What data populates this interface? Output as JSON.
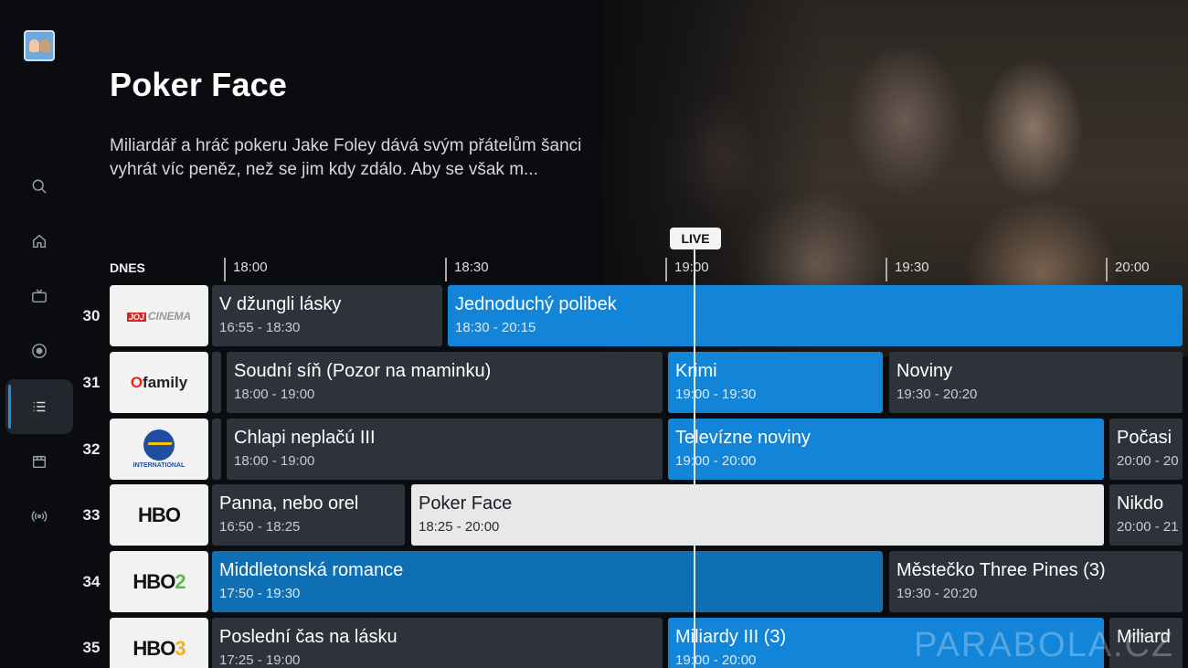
{
  "sidebar": {
    "items": [
      {
        "icon": "search-icon"
      },
      {
        "icon": "home-icon"
      },
      {
        "icon": "tv-icon"
      },
      {
        "icon": "record-icon"
      },
      {
        "icon": "list-icon",
        "active": true
      },
      {
        "icon": "movie-icon"
      },
      {
        "icon": "broadcast-icon"
      }
    ]
  },
  "hero": {
    "title": "Poker Face",
    "description": "Miliardář a hráč pokeru Jake Foley dává svým přátelům šanci vyhrát víc peněz, než se jim kdy zdálo. Aby se však m..."
  },
  "timeline": {
    "day_label": "DNES",
    "ticks": [
      "18:00",
      "18:30",
      "19:00",
      "19:30",
      "20:00"
    ],
    "live_label": "LIVE"
  },
  "channels": [
    {
      "number": "30",
      "logo": "JOJ CINEMA",
      "programs": [
        {
          "title": "V džungli lásky",
          "time": "16:55 - 18:30"
        },
        {
          "title": "Jednoduchý polibek",
          "time": "18:30 - 20:15"
        }
      ]
    },
    {
      "number": "31",
      "logo": "family",
      "programs": [
        {
          "title": "Soudní síň (Pozor na maminku)",
          "time": "18:00 - 19:00"
        },
        {
          "title": "Krimi",
          "time": "19:00 - 19:30"
        },
        {
          "title": "Noviny",
          "time": "19:30 - 20:20"
        }
      ]
    },
    {
      "number": "32",
      "logo": "INTERNATIONAL",
      "programs": [
        {
          "title": "Chlapi neplačú III",
          "time": "18:00 - 19:00"
        },
        {
          "title": "Televízne noviny",
          "time": "19:00 - 20:00"
        },
        {
          "title": "Počasi",
          "time": "20:00 - 20"
        }
      ]
    },
    {
      "number": "33",
      "logo": "HBO",
      "programs": [
        {
          "title": "Panna, nebo orel",
          "time": "16:50 - 18:25"
        },
        {
          "title": "Poker Face",
          "time": "18:25 - 20:00"
        },
        {
          "title": "Nikdo",
          "time": "20:00 - 21"
        }
      ]
    },
    {
      "number": "34",
      "logo": "HBO2",
      "programs": [
        {
          "title": "Middletonská romance",
          "time": "17:50 - 19:30"
        },
        {
          "title": "Městečko Three Pines (3)",
          "time": "19:30 - 20:20"
        }
      ]
    },
    {
      "number": "35",
      "logo": "HBO3",
      "programs": [
        {
          "title": "Poslední čas na lásku",
          "time": "17:25 - 19:00"
        },
        {
          "title": "Miliardy III (3)",
          "time": "19:00 - 20:00"
        },
        {
          "title": "Miliard",
          "time": ""
        }
      ]
    }
  ],
  "logos": {
    "joj_prefix": "JOJ",
    "joj_name": "CINEMA",
    "family_o": "O",
    "family_name": "family",
    "intl_name": "INTERNATIONAL",
    "hbo": "HBO",
    "hbo2_digit": "2",
    "hbo3_digit": "3"
  },
  "watermark": "PARABOLA.CZ",
  "colors": {
    "accent_blue": "#1285d8",
    "dark_blue": "#0f6fb4",
    "cell_gray": "#2e323a",
    "selected": "#e7e8ea"
  }
}
